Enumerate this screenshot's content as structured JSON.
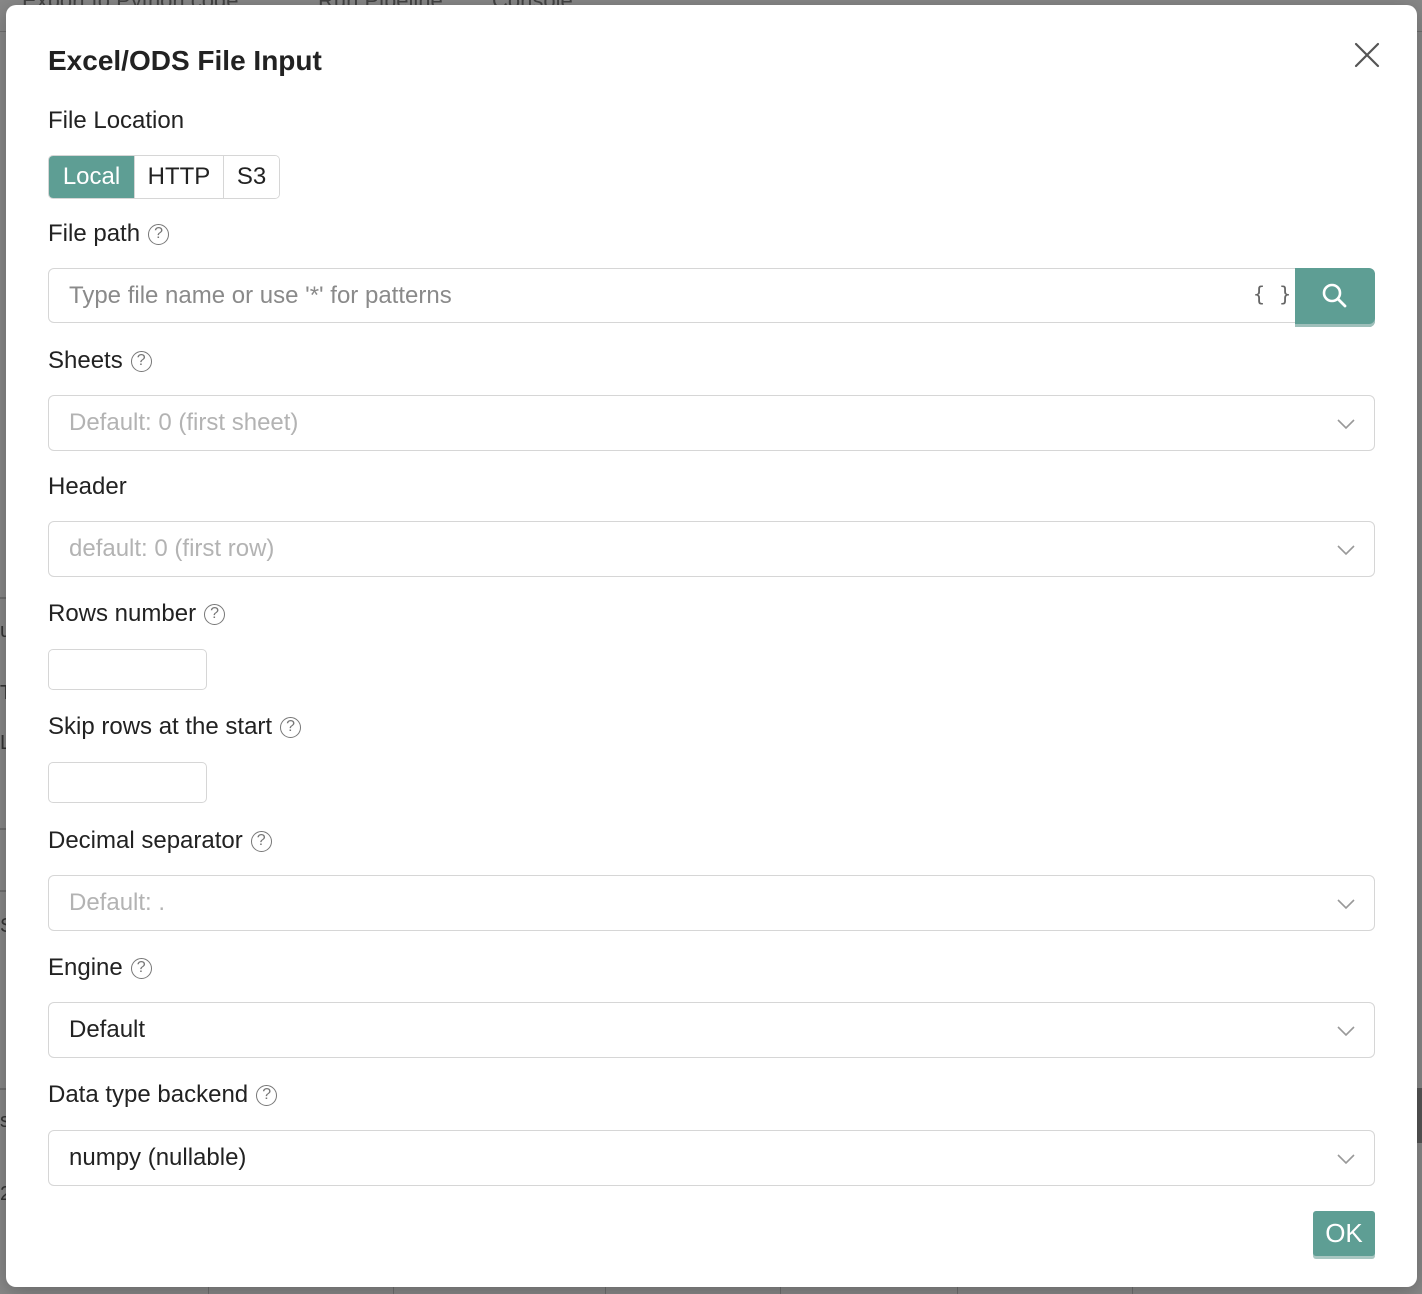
{
  "background": {
    "toolbar_items": [
      "Export to Python code",
      "Run Pipeline",
      "Console"
    ],
    "fragments": [
      "u",
      "T",
      "L",
      "S",
      "s",
      "2"
    ]
  },
  "modal": {
    "title": "Excel/ODS File Input",
    "close_icon": "close-icon",
    "file_location": {
      "label": "File Location",
      "options": [
        "Local",
        "HTTP",
        "S3"
      ],
      "selected": "Local"
    },
    "file_path": {
      "label": "File path",
      "placeholder": "Type file name or use '*' for patterns",
      "value": "",
      "variable_icon": "{ }",
      "search_icon": "search-icon"
    },
    "sheets": {
      "label": "Sheets",
      "placeholder": "Default: 0 (first sheet)"
    },
    "header": {
      "label": "Header",
      "placeholder": "default: 0 (first row)"
    },
    "rows_number": {
      "label": "Rows number",
      "value": ""
    },
    "skip_rows": {
      "label": "Skip rows at the start",
      "value": ""
    },
    "decimal_separator": {
      "label": "Decimal separator",
      "placeholder": "Default: ."
    },
    "engine": {
      "label": "Engine",
      "value": "Default"
    },
    "data_type_backend": {
      "label": "Data type backend",
      "value": "numpy (nullable)"
    },
    "help_symbol": "?",
    "ok_label": "OK"
  },
  "colors": {
    "accent": "#5e9e94",
    "border": "#d6d6d6",
    "placeholder": "#b3b3b3"
  }
}
